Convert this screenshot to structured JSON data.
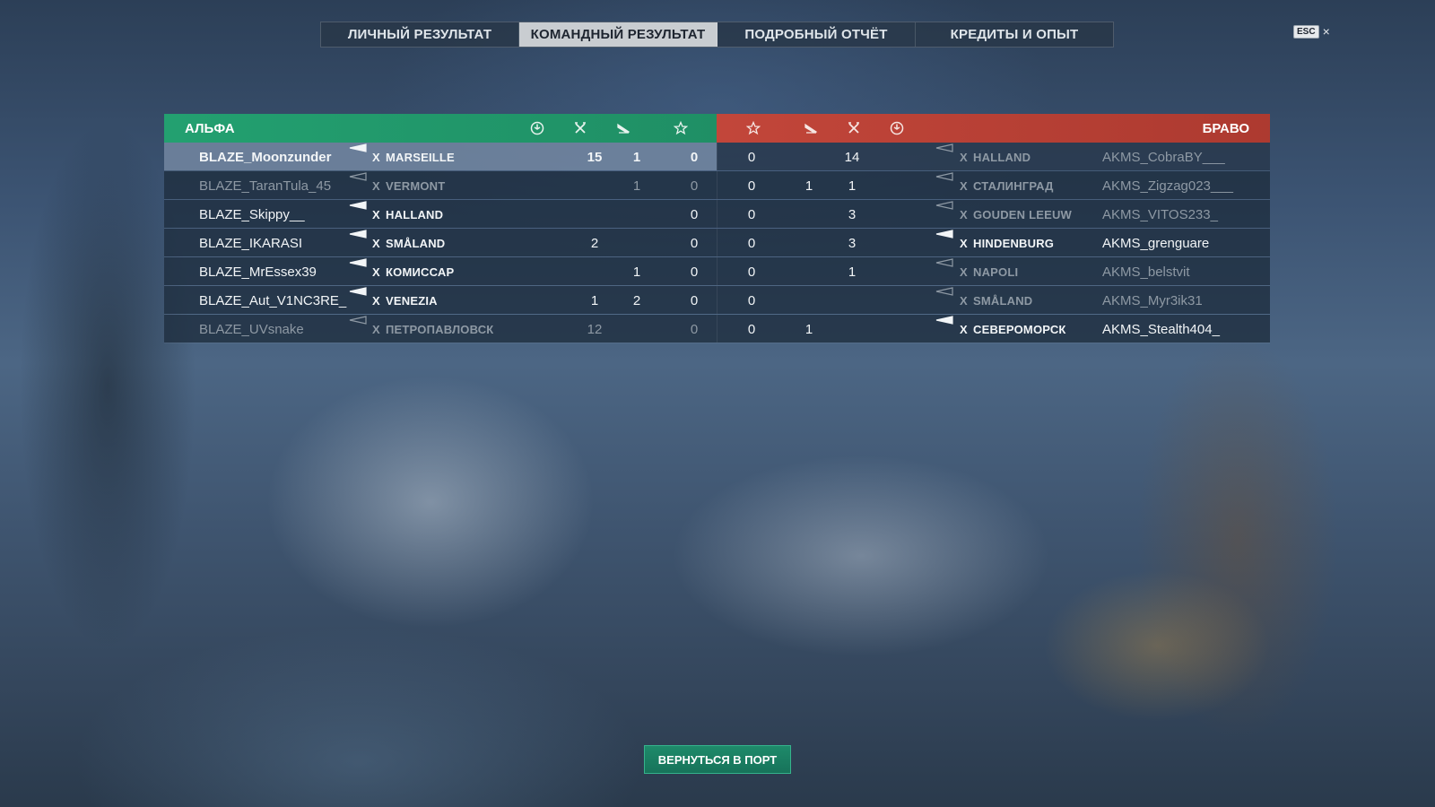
{
  "tabs": [
    {
      "label": "ЛИЧНЫЙ РЕЗУЛЬТАТ",
      "active": false
    },
    {
      "label": "КОМАНДНЫЙ РЕЗУЛЬТАТ",
      "active": true
    },
    {
      "label": "ПОДРОБНЫЙ ОТЧЁТ",
      "active": false
    },
    {
      "label": "КРЕДИТЫ И ОПЫТ",
      "active": false
    }
  ],
  "esc_key": "ESC",
  "close_glyph": "×",
  "teams": {
    "left_name": "АЛЬФА",
    "right_name": "БРАВО",
    "left_color": "#23a070",
    "right_color": "#c2463a"
  },
  "column_icons": [
    "base-capture-icon",
    "kills-icon",
    "planes-icon",
    "star-icon"
  ],
  "alpha": [
    {
      "player": "BLAZE_Moonzunder",
      "tier": "X",
      "ship": "MARSEILLE",
      "captures": "",
      "kills": "15",
      "planes": "1",
      "stars": "0",
      "alive": true,
      "highlight": true
    },
    {
      "player": "BLAZE_TaranTula_45",
      "tier": "X",
      "ship": "VERMONT",
      "captures": "",
      "kills": "",
      "planes": "1",
      "stars": "0",
      "alive": false
    },
    {
      "player": "BLAZE_Skippy__",
      "tier": "X",
      "ship": "HALLAND",
      "captures": "",
      "kills": "",
      "planes": "",
      "stars": "0",
      "alive": true
    },
    {
      "player": "BLAZE_IKARASI",
      "tier": "X",
      "ship": "SMÅLAND",
      "captures": "",
      "kills": "2",
      "planes": "",
      "stars": "0",
      "alive": true
    },
    {
      "player": "BLAZE_MrEssex39",
      "tier": "X",
      "ship": "КОМИССАР",
      "captures": "",
      "kills": "",
      "planes": "1",
      "stars": "0",
      "alive": true
    },
    {
      "player": "BLAZE_Aut_V1NC3RE_",
      "tier": "X",
      "ship": "VENEZIA",
      "captures": "",
      "kills": "1",
      "planes": "2",
      "stars": "0",
      "alive": true
    },
    {
      "player": "BLAZE_UVsnake",
      "tier": "X",
      "ship": "ПЕТРОПАВЛОВСК",
      "captures": "",
      "kills": "12",
      "planes": "",
      "stars": "0",
      "alive": false
    }
  ],
  "bravo": [
    {
      "player": "AKMS_CobraBY___",
      "tier": "X",
      "ship": "HALLAND",
      "stars": "0",
      "planes": "",
      "kills": "14",
      "captures": "",
      "alive": false
    },
    {
      "player": "AKMS_Zigzag023___",
      "tier": "X",
      "ship": "СТАЛИНГРАД",
      "stars": "0",
      "planes": "1",
      "kills": "1",
      "captures": "",
      "alive": false
    },
    {
      "player": "AKMS_VITOS233_",
      "tier": "X",
      "ship": "GOUDEN LEEUW",
      "stars": "0",
      "planes": "",
      "kills": "3",
      "captures": "",
      "alive": false
    },
    {
      "player": "AKMS_grenguare",
      "tier": "X",
      "ship": "HINDENBURG",
      "stars": "0",
      "planes": "",
      "kills": "3",
      "captures": "",
      "alive": true
    },
    {
      "player": "AKMS_belstvit",
      "tier": "X",
      "ship": "NAPOLI",
      "stars": "0",
      "planes": "",
      "kills": "1",
      "captures": "",
      "alive": false
    },
    {
      "player": "AKMS_Myr3ik31",
      "tier": "X",
      "ship": "SMÅLAND",
      "stars": "0",
      "planes": "",
      "kills": "",
      "captures": "",
      "alive": false
    },
    {
      "player": "AKMS_Stealth404_",
      "tier": "X",
      "ship": "СЕВЕРОМОРСК",
      "stars": "0",
      "planes": "1",
      "kills": "",
      "captures": "",
      "alive": true
    }
  ],
  "return_button": "ВЕРНУТЬСЯ В ПОРТ"
}
